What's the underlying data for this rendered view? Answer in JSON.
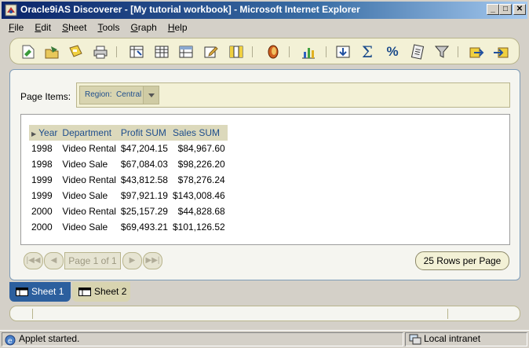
{
  "window": {
    "title": "Oracle9iAS Discoverer - [My tutorial workbook] - Microsoft Internet Explorer",
    "minimize": "_",
    "maximize": "□",
    "close": "✕"
  },
  "menu": {
    "items": [
      {
        "label": "File",
        "key": "F",
        "rest": "ile"
      },
      {
        "label": "Edit",
        "key": "E",
        "rest": "dit"
      },
      {
        "label": "Sheet",
        "key": "S",
        "rest": "heet"
      },
      {
        "label": "Tools",
        "key": "T",
        "rest": "ools"
      },
      {
        "label": "Graph",
        "key": "G",
        "rest": "raph"
      },
      {
        "label": "Help",
        "key": "H",
        "rest": "elp"
      }
    ]
  },
  "toolbar": {
    "icons": [
      "new-workbook-icon",
      "open-workbook-icon",
      "save-icon",
      "print-icon",
      "table-layout-icon",
      "crosstab-icon",
      "page-detail-icon",
      "edit-sheet-icon",
      "columns-icon",
      "oracle-icon",
      "graph-icon",
      "drill-icon",
      "sum-icon",
      "percent-icon",
      "calculation-icon",
      "filter-icon",
      "export-icon",
      "import-icon"
    ]
  },
  "page_items": {
    "label": "Page Items:",
    "region_label": "Region:",
    "region_value": "Central"
  },
  "table": {
    "headers": [
      "Year",
      "Department",
      "Profit SUM",
      "Sales SUM"
    ],
    "rows": [
      [
        "1998",
        "Video Rental",
        "$47,204.15",
        "$84,967.60"
      ],
      [
        "1998",
        "Video Sale",
        "$67,084.03",
        "$98,226.20"
      ],
      [
        "1999",
        "Video Rental",
        "$43,812.58",
        "$78,276.24"
      ],
      [
        "1999",
        "Video Sale",
        "$97,921.19",
        "$143,008.46"
      ],
      [
        "2000",
        "Video Rental",
        "$25,157.29",
        "$44,828.68"
      ],
      [
        "2000",
        "Video Sale",
        "$69,493.21",
        "$101,126.52"
      ]
    ]
  },
  "pager": {
    "first": "|◀◀",
    "prev": "◀",
    "page_label": "Page 1 of 1",
    "next": "▶",
    "last": "▶▶|",
    "rows_per_page": "25 Rows per Page"
  },
  "sheets": {
    "tab1": "Sheet 1",
    "tab2": "Sheet 2"
  },
  "statusbar": {
    "message": "Applet started.",
    "zone": "Local intranet"
  }
}
